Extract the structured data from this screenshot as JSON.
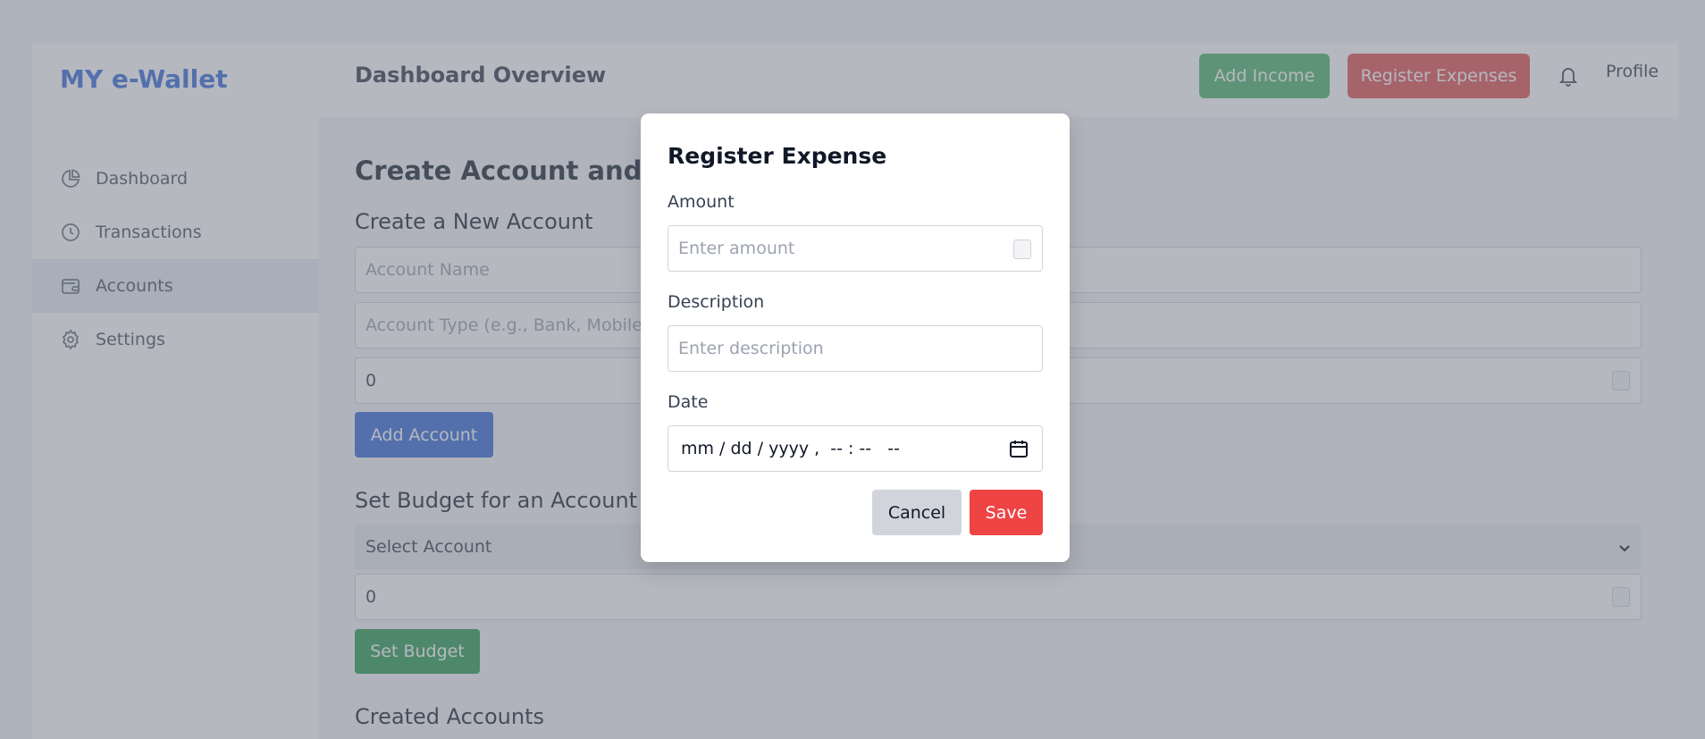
{
  "app": {
    "logo": "MY e-Wallet"
  },
  "sidebar": {
    "items": [
      {
        "label": "Dashboard",
        "icon": "chart-pie-icon"
      },
      {
        "label": "Transactions",
        "icon": "clock-icon"
      },
      {
        "label": "Accounts",
        "icon": "wallet-icon",
        "active": true
      },
      {
        "label": "Settings",
        "icon": "gear-icon"
      }
    ]
  },
  "header": {
    "title": "Dashboard Overview",
    "add_income": "Add Income",
    "register_expenses": "Register Expenses",
    "profile": "Profile"
  },
  "main": {
    "section_title": "Create Account and Se",
    "create_account": {
      "heading": "Create a New Account",
      "name_placeholder": "Account Name",
      "type_placeholder": "Account Type (e.g., Bank, Mobile M",
      "balance_value": "0",
      "button": "Add Account"
    },
    "budget": {
      "heading": "Set Budget for an Account",
      "select_value": "Select Account",
      "amount_value": "0",
      "button": "Set Budget"
    },
    "created_heading": "Created Accounts"
  },
  "modal": {
    "title": "Register Expense",
    "amount_label": "Amount",
    "amount_placeholder": "Enter amount",
    "description_label": "Description",
    "description_placeholder": "Enter description",
    "date_label": "Date",
    "date_value": "mm / dd / yyyy ,  -- : --   --",
    "cancel": "Cancel",
    "save": "Save"
  },
  "colors": {
    "primary": "#3b6fd8",
    "income": "#52b46f",
    "expense": "#e05555",
    "save": "#ef4444"
  }
}
